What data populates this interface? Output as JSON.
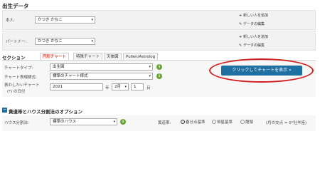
{
  "page": {
    "heading": "出生データ"
  },
  "person1": {
    "label": "本人:",
    "value": "かつき かなこ"
  },
  "person2": {
    "label": "パートナー:",
    "value": "かつき かなこ"
  },
  "links": {
    "add_new": "新しい人を追加",
    "edit_data": "データの編集"
  },
  "section": {
    "label": "セクション",
    "tabs": [
      {
        "label": "円形チャート",
        "active": true
      },
      {
        "label": "特殊チャート",
        "active": false
      },
      {
        "label": "天体図",
        "active": false
      },
      {
        "label": "Pullen/Astrolog",
        "active": false
      }
    ]
  },
  "form": {
    "chart_type_label": "チャートタイプ:",
    "chart_type_value": "出生図",
    "chart_style_label": "チャート表現様式:",
    "chart_style_value": "標準のチャート様式",
    "date_label": "表わしたいチャート",
    "date_sublabel": "(*) の日付",
    "year_value": "2021",
    "year_unit": "年",
    "month_value": "2月",
    "day_value": "1",
    "day_unit": "日"
  },
  "show_chart_button": "クリックしてチャートを表示 »",
  "options": {
    "heading": "黄道帯とハウス分割法のオプション",
    "house_label": "ハウス分割法:",
    "house_value": "標準のハウス",
    "zodiac_label": "黄道帯:",
    "zodiac_options": [
      {
        "label": "春分点基準",
        "selected": true
      },
      {
        "label": "恒星基準",
        "selected": false
      },
      {
        "label": "龍頭",
        "selected": false
      }
    ],
    "zodiac_note": "(月の交点 = 0°牡羊座)"
  },
  "colors": {
    "accent_tab": "#d6402a",
    "button": "#1f6fa3",
    "highlight_oval": "#d21f1f",
    "info_icon": "#6aa334"
  }
}
